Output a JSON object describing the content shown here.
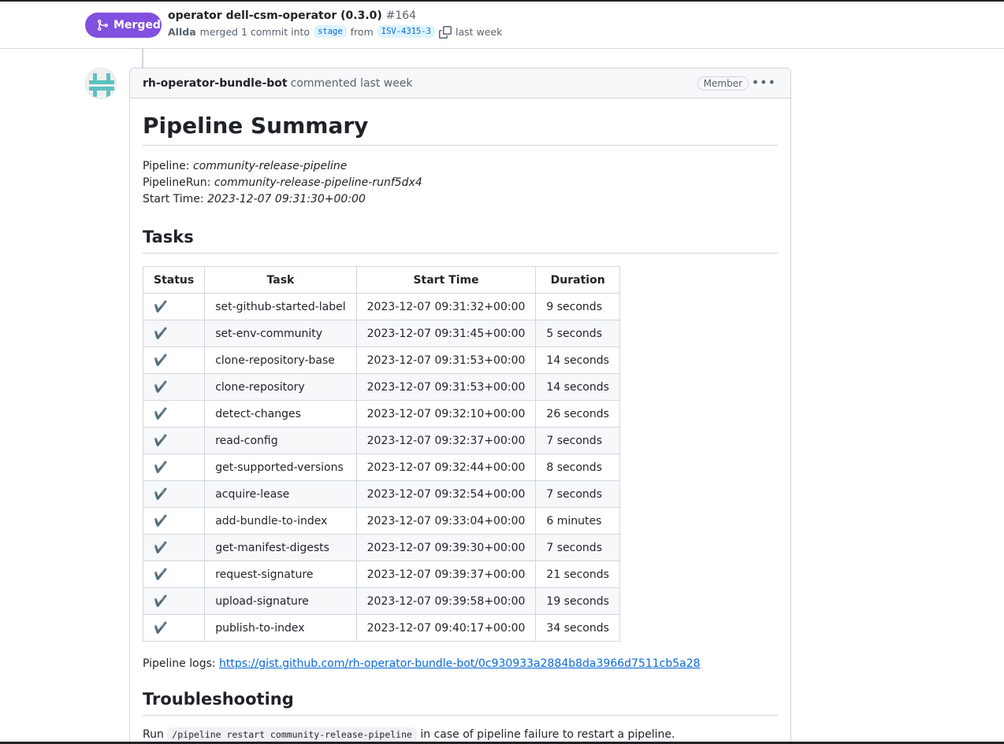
{
  "header": {
    "status_badge": "Merged",
    "title": "operator dell-csm-operator (0.3.0)",
    "number": "#164",
    "author": "Allda",
    "merged_text": "merged 1 commit into",
    "base_branch": "stage",
    "from_text": "from",
    "head_branch": "ISV-4315-3",
    "time": "last week"
  },
  "comment": {
    "author": "rh-operator-bundle-bot",
    "meta": "commented last week",
    "role_badge": "Member",
    "heading": "Pipeline Summary",
    "pipeline_label": "Pipeline: ",
    "pipeline_value": "community-release-pipeline",
    "pipelinerun_label": "PipelineRun: ",
    "pipelinerun_value": "community-release-pipeline-runf5dx4",
    "start_label": "Start Time: ",
    "start_value": "2023-12-07 09:31:30+00:00",
    "tasks_heading": "Tasks",
    "table": {
      "headers": [
        "Status",
        "Task",
        "Start Time",
        "Duration"
      ],
      "rows": [
        {
          "status": "✔️",
          "task": "set-github-started-label",
          "start": "2023-12-07 09:31:32+00:00",
          "duration": "9 seconds"
        },
        {
          "status": "✔️",
          "task": "set-env-community",
          "start": "2023-12-07 09:31:45+00:00",
          "duration": "5 seconds"
        },
        {
          "status": "✔️",
          "task": "clone-repository-base",
          "start": "2023-12-07 09:31:53+00:00",
          "duration": "14 seconds"
        },
        {
          "status": "✔️",
          "task": "clone-repository",
          "start": "2023-12-07 09:31:53+00:00",
          "duration": "14 seconds"
        },
        {
          "status": "✔️",
          "task": "detect-changes",
          "start": "2023-12-07 09:32:10+00:00",
          "duration": "26 seconds"
        },
        {
          "status": "✔️",
          "task": "read-config",
          "start": "2023-12-07 09:32:37+00:00",
          "duration": "7 seconds"
        },
        {
          "status": "✔️",
          "task": "get-supported-versions",
          "start": "2023-12-07 09:32:44+00:00",
          "duration": "8 seconds"
        },
        {
          "status": "✔️",
          "task": "acquire-lease",
          "start": "2023-12-07 09:32:54+00:00",
          "duration": "7 seconds"
        },
        {
          "status": "✔️",
          "task": "add-bundle-to-index",
          "start": "2023-12-07 09:33:04+00:00",
          "duration": "6 minutes"
        },
        {
          "status": "✔️",
          "task": "get-manifest-digests",
          "start": "2023-12-07 09:39:30+00:00",
          "duration": "7 seconds"
        },
        {
          "status": "✔️",
          "task": "request-signature",
          "start": "2023-12-07 09:39:37+00:00",
          "duration": "21 seconds"
        },
        {
          "status": "✔️",
          "task": "upload-signature",
          "start": "2023-12-07 09:39:58+00:00",
          "duration": "19 seconds"
        },
        {
          "status": "✔️",
          "task": "publish-to-index",
          "start": "2023-12-07 09:40:17+00:00",
          "duration": "34 seconds"
        }
      ]
    },
    "logs_label": "Pipeline logs: ",
    "logs_url": "https://gist.github.com/rh-operator-bundle-bot/0c930933a2884b8da3966d7511cb5a28",
    "troubleshooting_heading": "Troubleshooting",
    "run_prefix": "Run ",
    "run_command": "/pipeline restart community-release-pipeline",
    "run_suffix": " in case of pipeline failure to restart a pipeline."
  },
  "colors": {
    "merged": "#8250df",
    "link": "#0969da",
    "border": "#d0d7de"
  }
}
